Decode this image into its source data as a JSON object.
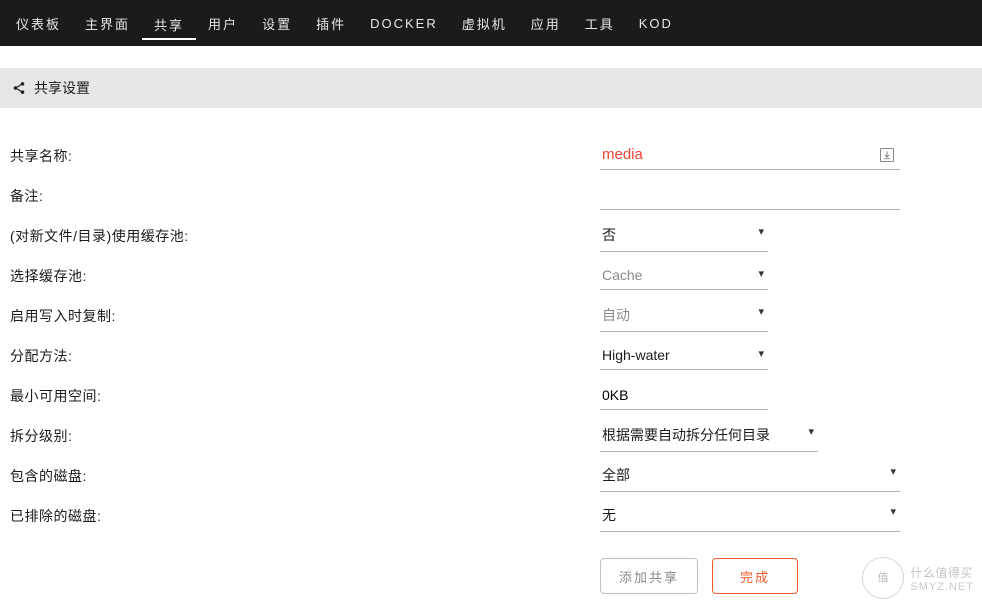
{
  "nav": {
    "items": [
      {
        "label": "仪表板"
      },
      {
        "label": "主界面"
      },
      {
        "label": "共享",
        "active": true
      },
      {
        "label": "用户"
      },
      {
        "label": "设置"
      },
      {
        "label": "插件"
      },
      {
        "label": "DOCKER"
      },
      {
        "label": "虚拟机"
      },
      {
        "label": "应用"
      },
      {
        "label": "工具"
      },
      {
        "label": "KOD"
      }
    ]
  },
  "section": {
    "title": "共享设置"
  },
  "form": {
    "share_name": {
      "label": "共享名称:",
      "value": "media"
    },
    "comment": {
      "label": "备注:",
      "value": ""
    },
    "use_cache": {
      "label": "(对新文件/目录)使用缓存池:",
      "value": "否"
    },
    "cache_pool": {
      "label": "选择缓存池:",
      "value": "Cache"
    },
    "cow": {
      "label": "启用写入时复制:",
      "value": "自动"
    },
    "alloc": {
      "label": "分配方法:",
      "value": "High-water"
    },
    "min_free": {
      "label": "最小可用空间:",
      "value": "0KB"
    },
    "split": {
      "label": "拆分级别:",
      "value": "根据需要自动拆分任何目录"
    },
    "included": {
      "label": "包含的磁盘:",
      "value": "全部"
    },
    "excluded": {
      "label": "已排除的磁盘:",
      "value": "无"
    }
  },
  "buttons": {
    "add": "添加共享",
    "done": "完成"
  },
  "watermark": {
    "circle": "值",
    "line1": "什么值得买",
    "line2": "SMYZ.NET"
  }
}
